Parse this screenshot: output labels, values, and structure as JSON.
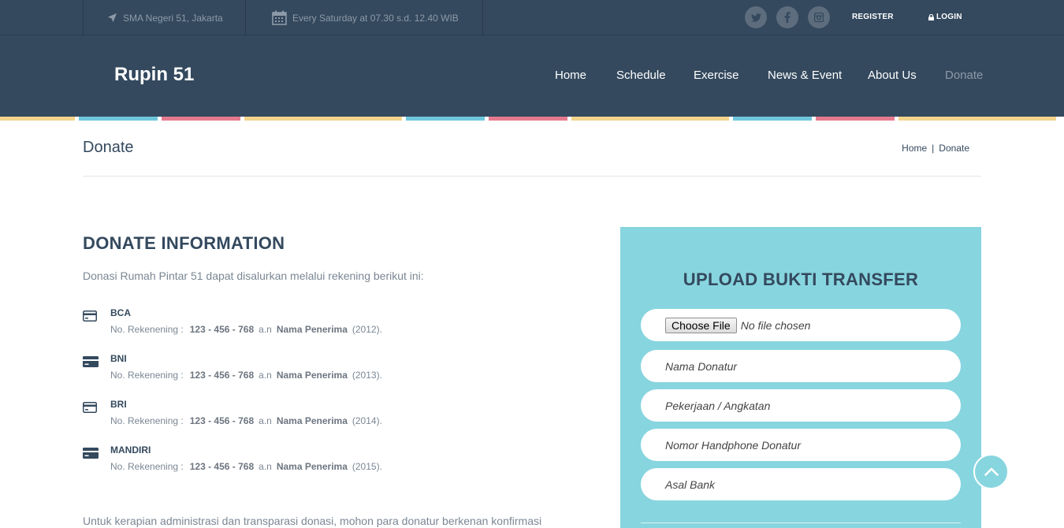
{
  "topbar": {
    "location": "SMA Negeri 51, Jakarta",
    "schedule": "Every Saturday at 07.30 s.d. 12.40 WIB",
    "register": "REGISTER",
    "login": "LOGIN"
  },
  "header": {
    "logo": "Rupin 51",
    "nav": [
      "Home",
      "Schedule",
      "Exercise",
      "News & Event",
      "About Us",
      "Donate"
    ],
    "active": "Donate"
  },
  "page": {
    "title": "Donate",
    "breadcrumb": [
      "Home",
      "Donate"
    ],
    "breadcrumb_sep": "|"
  },
  "info": {
    "heading": "DONATE INFORMATION",
    "intro": "Donasi Rumah Pintar 51 dapat disalurkan melalui rekening berikut ini:",
    "account_label": "No. Rekenening :",
    "an_label": "a.n",
    "banks": [
      {
        "name": "BCA",
        "number": "123 - 456 - 768",
        "holder": "Nama Penerima",
        "year": "(2012)."
      },
      {
        "name": "BNI",
        "number": "123 - 456 - 768",
        "holder": "Nama Penerima",
        "year": "(2013)."
      },
      {
        "name": "BRI",
        "number": "123 - 456 - 768",
        "holder": "Nama Penerima",
        "year": "(2014)."
      },
      {
        "name": "MANDIRI",
        "number": "123 - 456 - 768",
        "holder": "Nama Penerima",
        "year": "(2015)."
      }
    ],
    "note": "Untuk kerapian administrasi dan transparasi donasi, mohon para donatur berkenan konfirmasi"
  },
  "upload": {
    "title": "UPLOAD BUKTI TRANSFER",
    "file_button": "Choose File",
    "file_status": "No file chosen",
    "placeholders": [
      "Nama Donatur",
      "Pekerjaan / Angkatan",
      "Nomor Handphone Donatur",
      "Asal Bank"
    ]
  },
  "colors": {
    "navy": "#34495e",
    "panel": "#87d5df",
    "stripe_yellow": "#f3d48b",
    "stripe_blue": "#6fc7dd",
    "stripe_pink": "#e57a8f"
  }
}
